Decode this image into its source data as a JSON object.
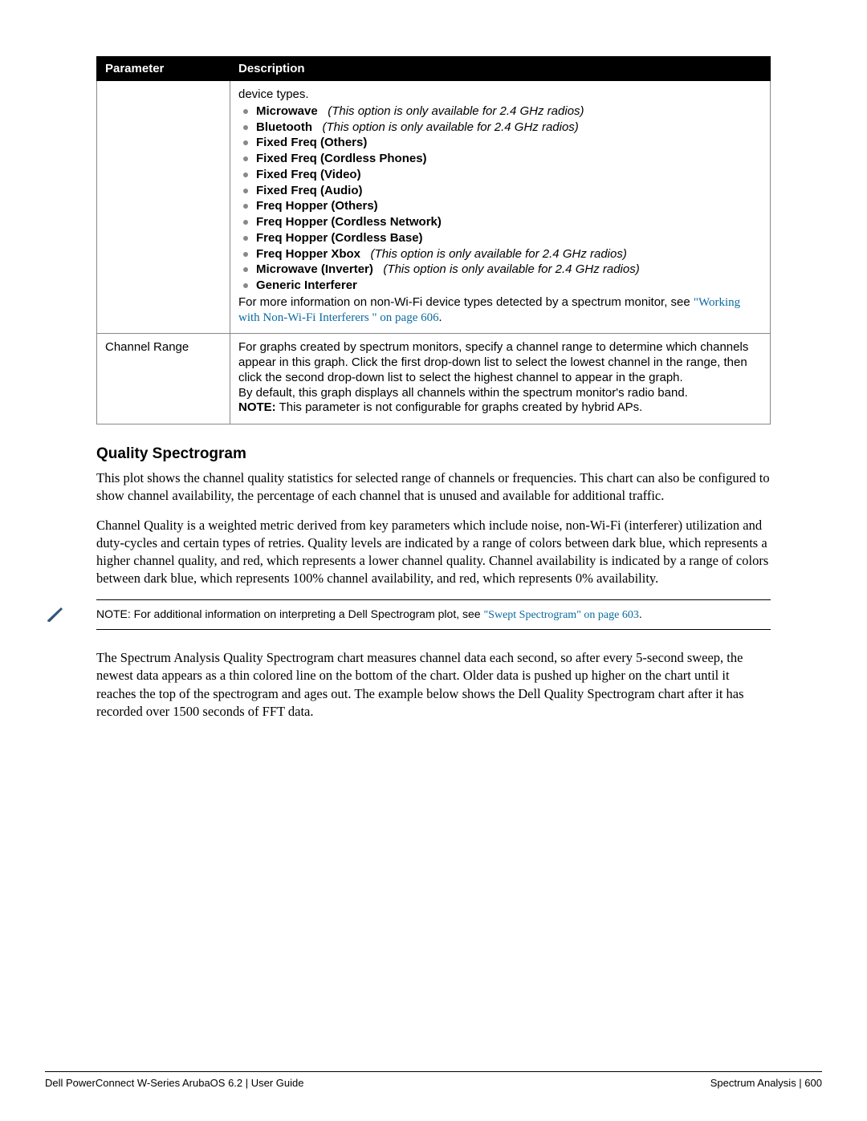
{
  "table": {
    "header_param": "Parameter",
    "header_desc": "Description",
    "row1": {
      "intro": "device types.",
      "items": [
        {
          "bold": "Microwave",
          "ital": "(This option is only available for 2.4 GHz radios)"
        },
        {
          "bold": "Bluetooth",
          "ital": "(This option is only available for 2.4 GHz radios)"
        },
        {
          "bold": "Fixed Freq (Others)"
        },
        {
          "bold": "Fixed Freq (Cordless Phones)"
        },
        {
          "bold": "Fixed Freq (Video)"
        },
        {
          "bold": "Fixed Freq (Audio)"
        },
        {
          "bold": "Freq Hopper (Others)"
        },
        {
          "bold": "Freq Hopper (Cordless Network)"
        },
        {
          "bold": "Freq Hopper (Cordless Base)"
        },
        {
          "bold": "Freq Hopper Xbox",
          "ital": "(This option is only available for 2.4 GHz radios)"
        },
        {
          "bold": "Microwave (Inverter)",
          "ital": "(This option is only available for 2.4 GHz radios)"
        },
        {
          "bold": "Generic Interferer"
        }
      ],
      "post_text": "For more information on non-Wi-Fi device types detected by a spectrum monitor, see ",
      "post_link": "\"Working with Non-Wi-Fi Interferers \" on page 606",
      "post_end": "."
    },
    "row2": {
      "param": "Channel Range",
      "l1": "For graphs created by spectrum monitors, specify a channel range to determine which channels appear in this graph. Click the first drop-down list to select the lowest channel in the range, then click the second drop-down list to select the highest channel to appear in the graph.",
      "l2": "By default, this graph displays all channels within the spectrum monitor's radio band.",
      "l3a": "NOTE:",
      "l3b": " This parameter is not configurable for graphs created by hybrid APs."
    }
  },
  "section": {
    "heading": "Quality Spectrogram",
    "p1": "This plot shows the channel quality statistics for selected range of channels or frequencies. This chart can also be configured to show channel availability, the percentage of each channel that is unused and available for additional traffic.",
    "p2": "Channel Quality is a weighted metric derived from key parameters which include noise, non-Wi-Fi (interferer) utilization and duty-cycles and certain types of retries. Quality levels are indicated by a range of colors between dark blue, which represents a higher channel quality, and red, which represents a lower channel quality. Channel availability is indicated by a range of colors between dark blue, which represents 100% channel availability, and red, which represents 0% availability.",
    "note_pre": "NOTE: For additional information on interpreting a  Dell Spectrogram plot, see ",
    "note_link": "\"Swept Spectrogram\" on page 603",
    "note_post": ".",
    "p3": "The Spectrum Analysis Quality Spectrogram chart measures channel data each second, so after every 5-second sweep, the newest data appears as a thin colored line on the bottom of the chart. Older data is pushed up higher on the chart until it reaches the top of the spectrogram and ages out. The example below shows the Dell Quality Spectrogram chart after it has recorded over 1500 seconds of FFT data."
  },
  "footer": {
    "left": "Dell PowerConnect W-Series ArubaOS 6.2 | User Guide",
    "right": "Spectrum Analysis  |  600"
  }
}
